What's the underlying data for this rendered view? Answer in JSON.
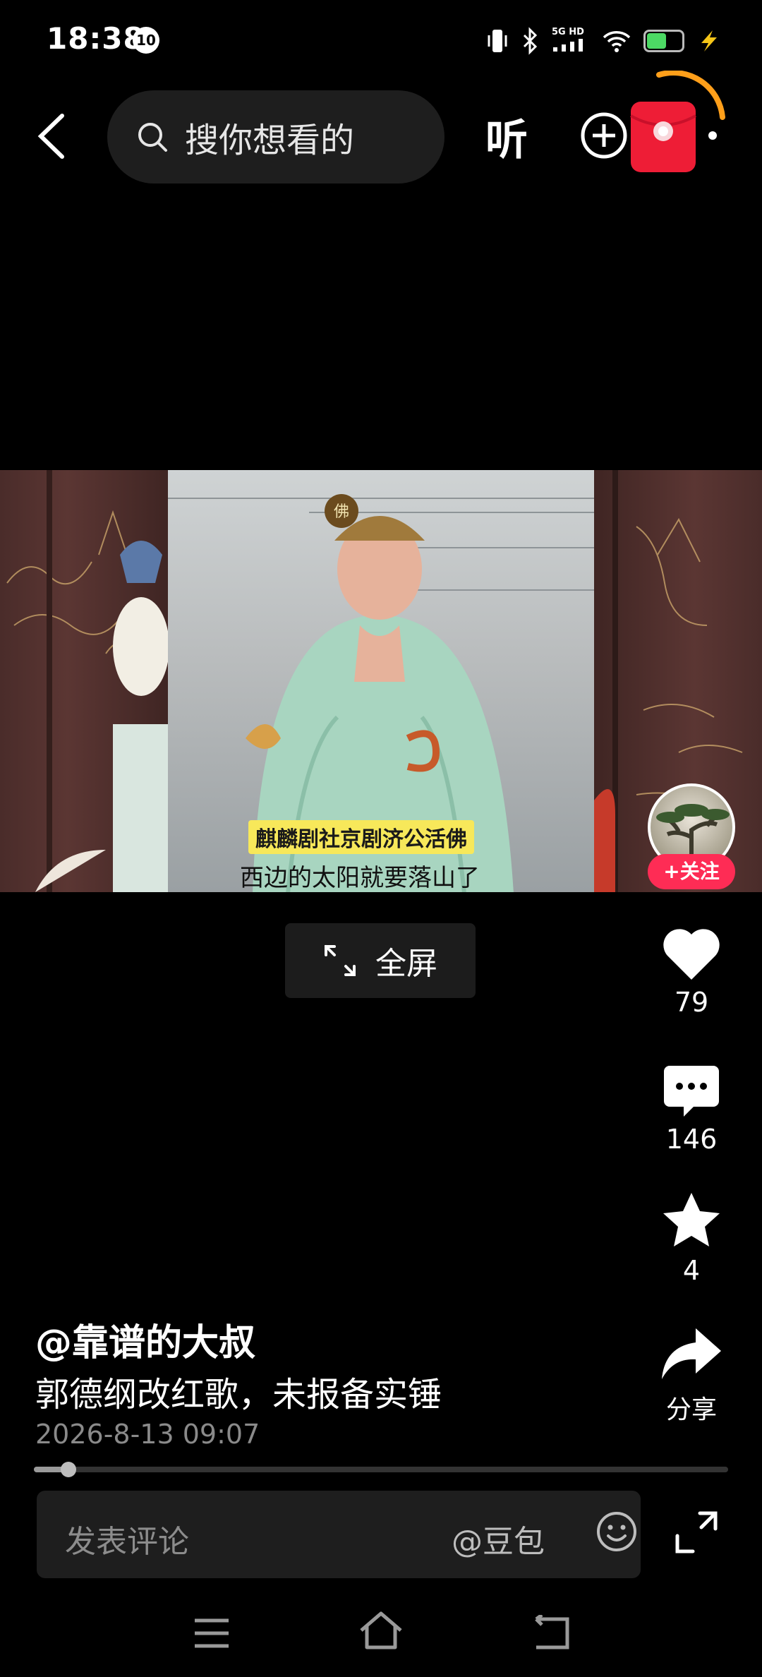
{
  "status_bar": {
    "time": "18:38",
    "badge": "10",
    "network": "5G HD",
    "icons": [
      "vibrate-icon",
      "bluetooth-icon",
      "signal-icon",
      "wifi-icon",
      "battery-icon",
      "charging-icon"
    ],
    "battery_level": 0.58
  },
  "top_nav": {
    "search_placeholder": "搜你想看的",
    "listen_label": "听",
    "icons": [
      "back-icon",
      "search-icon",
      "add-icon",
      "red-packet-icon",
      "more-icon"
    ]
  },
  "video": {
    "caption_top": "麒麟剧社京剧济公活佛",
    "caption_bottom": "西边的太阳就要落山了",
    "hat_mark": "佛"
  },
  "follow_label": "+关注",
  "fullscreen_label": "全屏",
  "actions": {
    "like_count": "79",
    "comment_count": "146",
    "favorite_count": "4",
    "share_label": "分享"
  },
  "post": {
    "author": "@靠谱的大叔",
    "description": "郭德纲改红歌，未报备实锤",
    "date": "2026-8-13 09:07",
    "progress": 0.05
  },
  "comment_bar": {
    "placeholder": "发表评论",
    "mention": "@豆包"
  },
  "colors": {
    "background": "#000000",
    "accent_red": "#fe2c55",
    "caption_yellow": "#f7e85a"
  }
}
